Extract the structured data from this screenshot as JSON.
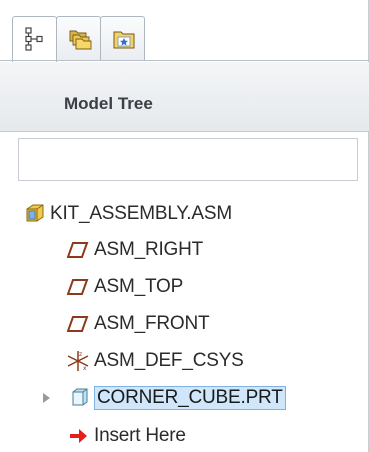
{
  "tabs": [
    {
      "name": "model-tree-tab",
      "icon": "tree-structure-icon"
    },
    {
      "name": "folder-browser-tab",
      "icon": "folders-icon"
    },
    {
      "name": "favorites-tab",
      "icon": "star-folder-icon"
    }
  ],
  "header": {
    "title": "Model Tree"
  },
  "tree": {
    "items": [
      {
        "label": "KIT_ASSEMBLY.ASM",
        "icon": "assembly-icon"
      },
      {
        "label": "ASM_RIGHT",
        "icon": "datum-plane-icon"
      },
      {
        "label": "ASM_TOP",
        "icon": "datum-plane-icon"
      },
      {
        "label": "ASM_FRONT",
        "icon": "datum-plane-icon"
      },
      {
        "label": "ASM_DEF_CSYS",
        "icon": "coordinate-system-icon"
      },
      {
        "label": "CORNER_CUBE.PRT",
        "icon": "part-icon"
      },
      {
        "label": "Insert Here",
        "icon": "insert-arrow-icon"
      }
    ]
  },
  "colors": {
    "plane": "#8b3a1a",
    "selection": "#cfe6fb",
    "insert_arrow": "#e3201b",
    "assembly": "#f2c94c"
  }
}
